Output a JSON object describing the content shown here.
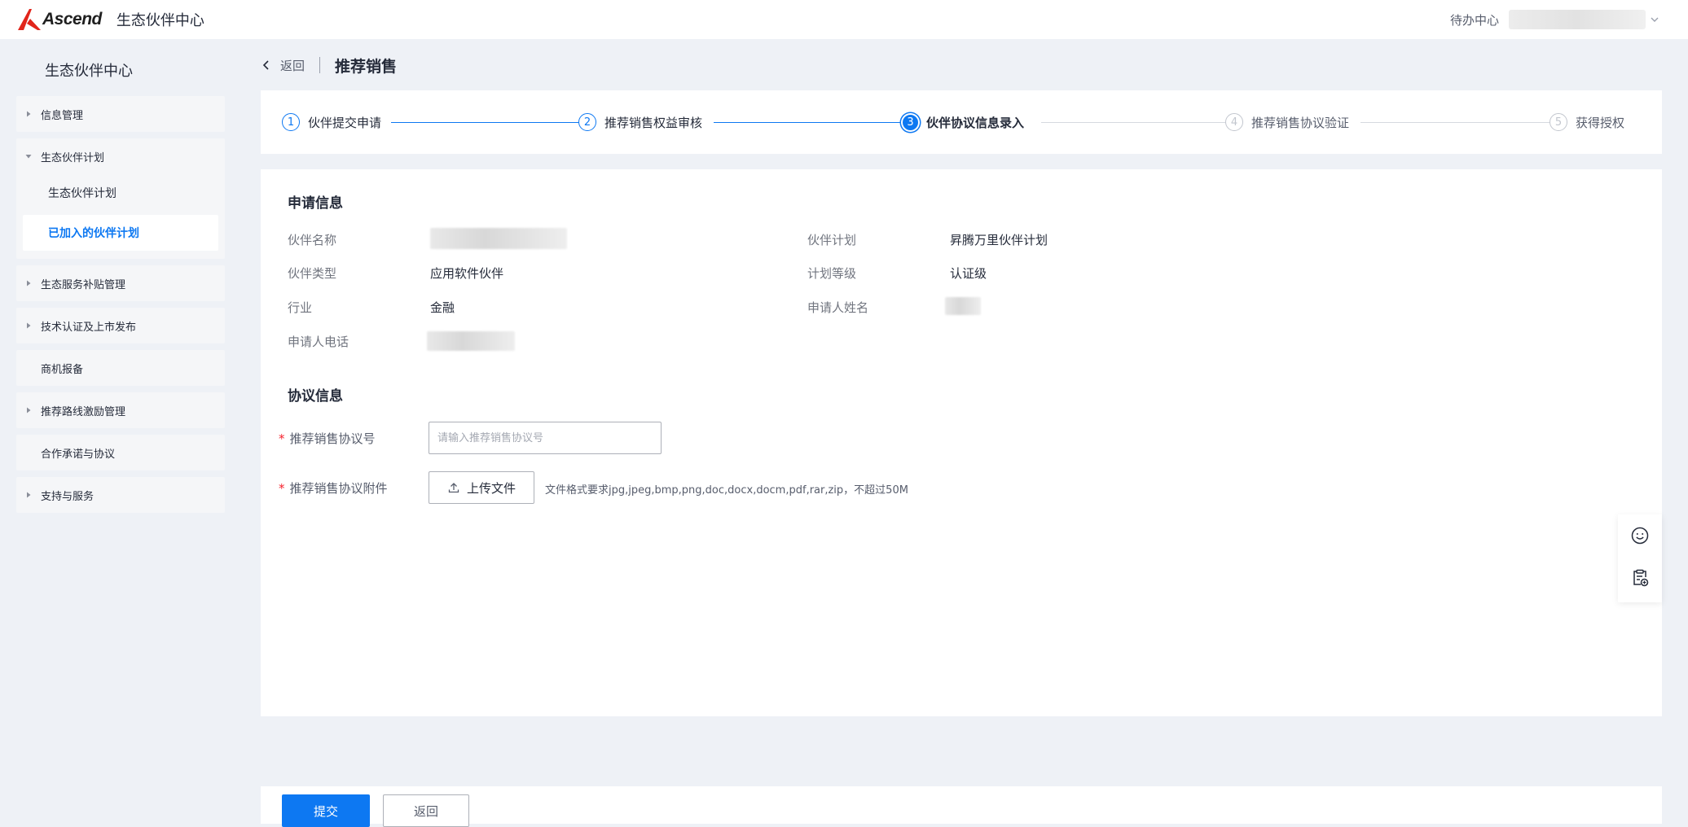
{
  "header": {
    "brand": "Ascend",
    "app_title": "生态伙伴中心",
    "todo_label": "待办中心"
  },
  "sidebar": {
    "title": "生态伙伴中心",
    "groups": [
      {
        "label": "信息管理",
        "expandable": true
      },
      {
        "label": "生态伙伴计划",
        "expandable": true,
        "expanded": true,
        "children": [
          {
            "label": "生态伙伴计划",
            "active": false
          },
          {
            "label": "已加入的伙伴计划",
            "active": true
          }
        ]
      },
      {
        "label": "生态服务补贴管理",
        "expandable": true
      },
      {
        "label": "技术认证及上市发布",
        "expandable": true
      },
      {
        "label": "商机报备",
        "expandable": false
      },
      {
        "label": "推荐路线激励管理",
        "expandable": true
      },
      {
        "label": "合作承诺与协议",
        "expandable": false
      },
      {
        "label": "支持与服务",
        "expandable": true
      }
    ]
  },
  "breadcrumb": {
    "back_label": "返回",
    "page_title": "推荐销售"
  },
  "steps": [
    {
      "num": "1",
      "label": "伙伴提交申请",
      "state": "done"
    },
    {
      "num": "2",
      "label": "推荐销售权益审核",
      "state": "done"
    },
    {
      "num": "3",
      "label": "伙伴协议信息录入",
      "state": "current"
    },
    {
      "num": "4",
      "label": "推荐销售协议验证",
      "state": "todo"
    },
    {
      "num": "5",
      "label": "获得授权",
      "state": "todo"
    }
  ],
  "application": {
    "section_title": "申请信息",
    "partner_name_label": "伙伴名称",
    "partner_plan_label": "伙伴计划",
    "partner_plan_value": "昇腾万里伙伴计划",
    "partner_type_label": "伙伴类型",
    "partner_type_value": "应用软件伙伴",
    "plan_level_label": "计划等级",
    "plan_level_value": "认证级",
    "industry_label": "行业",
    "industry_value": "金融",
    "applicant_name_label": "申请人姓名",
    "applicant_phone_label": "申请人电话"
  },
  "agreement": {
    "section_title": "协议信息",
    "number_label": "推荐销售协议号",
    "number_placeholder": "请输入推荐销售协议号",
    "number_value": "",
    "attachment_label": "推荐销售协议附件",
    "upload_label": "上传文件",
    "upload_hint": "文件格式要求jpg,jpeg,bmp,png,doc,docx,docm,pdf,rar,zip，不超过50M",
    "required_mark": "*"
  },
  "footer": {
    "submit_label": "提交",
    "back_label": "返回"
  },
  "colors": {
    "brand_red": "#e1251b",
    "accent_blue": "#0d78f2",
    "page_bg": "#eef1f6"
  }
}
